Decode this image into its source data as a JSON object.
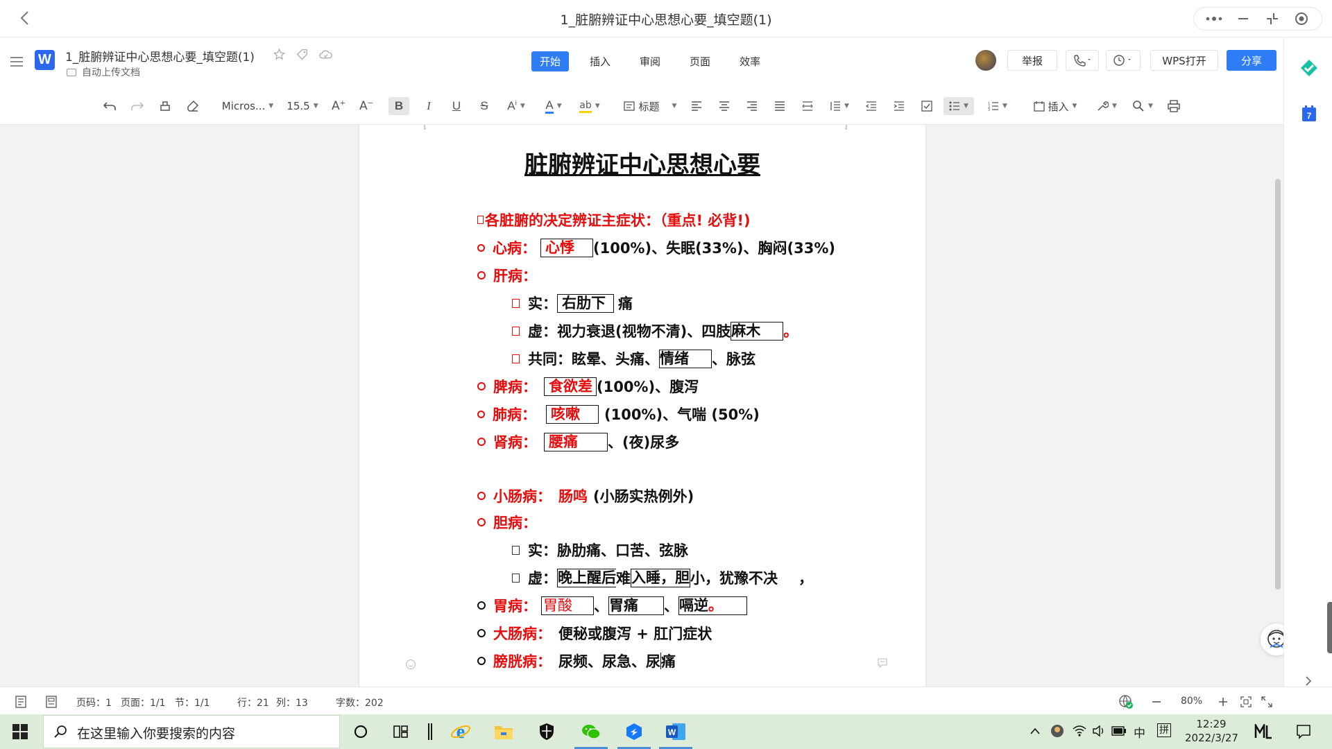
{
  "window": {
    "title": "1_脏腑辨证中心思想心要_填空题(1)"
  },
  "header": {
    "doc_name": "1_脏腑辨证中心思想心要_填空题(1)",
    "doc_status": "自动上传文档",
    "tabs": [
      {
        "label": "开始",
        "active": true
      },
      {
        "label": "插入",
        "active": false
      },
      {
        "label": "审阅",
        "active": false
      },
      {
        "label": "页面",
        "active": false
      },
      {
        "label": "效率",
        "active": false
      }
    ],
    "report_label": "举报",
    "wps_open_label": "WPS打开",
    "share_label": "分享"
  },
  "toolbar": {
    "font_name": "Micros...",
    "font_size": "15.5",
    "heading_style": "标题",
    "insert_label": "插入"
  },
  "document": {
    "title": "脏腑辨证中心思想心要",
    "section_heading": "各脏腑的决定辨证主症状：（重点! 必背!)",
    "heart": {
      "label": "心病：",
      "blank": "心悸",
      "rest": "(100%)、失眠(33%)、胸闷(33%)"
    },
    "liver": {
      "label": "肝病："
    },
    "liver_shi": {
      "prefix": "实：",
      "blank": "右肋下",
      "rest": "痛"
    },
    "liver_xu": {
      "prefix": "虚：视力衰退(视物不清)、四肢",
      "blank": "麻木",
      "rest": "。"
    },
    "liver_common": {
      "prefix": "共同：眩晕、头痛、",
      "blank": "情绪",
      "rest": "、脉弦"
    },
    "spleen": {
      "label": "脾病：",
      "blank": "食欲差",
      "rest": "(100%)、腹泻"
    },
    "lung": {
      "label": "肺病：",
      "blank": "咳嗽",
      "rest": "(100%)、气喘 (50%)"
    },
    "kidney": {
      "label": "肾病：",
      "blank": "腰痛",
      "rest": "、(夜)尿多"
    },
    "small_intestine": {
      "label": "小肠病：",
      "answer": "肠鸣",
      "rest": "(小肠实热例外)"
    },
    "gallbladder": {
      "label": "胆病："
    },
    "gb_shi": {
      "text": "实：胁肋痛、口苦、弦脉"
    },
    "gb_xu": {
      "prefix": "虚：",
      "blank1": "晚上醒后",
      "mid": "难",
      "blank2": "入睡，胆",
      "rest": "小，犹豫不决",
      "tail": "，"
    },
    "stomach": {
      "label": "胃病：",
      "blank1": "胃酸",
      "sep1": "、",
      "blank2": "胃痛",
      "sep2": "、",
      "blank3": "嗝逆",
      "tail": "。"
    },
    "large_intestine": {
      "label": "大肠病：",
      "rest": "便秘或腹泻 + 肛门症状"
    },
    "bladder": {
      "label": "膀胱病：",
      "rest_a": "尿频、尿急、尿",
      "rest_b": "痛"
    }
  },
  "statusbar": {
    "page_code": "页码：1",
    "pages": "页面：1/1",
    "section": "节：1/1",
    "row": "行：21",
    "col": "列：13",
    "word_count": "字数：202",
    "zoom": "80%"
  },
  "taskbar": {
    "search_placeholder": "在这里输入你要搜索的内容",
    "ime_lang": "中",
    "ime_mode": "拼",
    "time": "12:29",
    "date": "2022/3/27"
  },
  "colors": {
    "accent": "#2e7cf6",
    "answer_red": "#e50d0d",
    "taskbar": "#dcecd9"
  }
}
